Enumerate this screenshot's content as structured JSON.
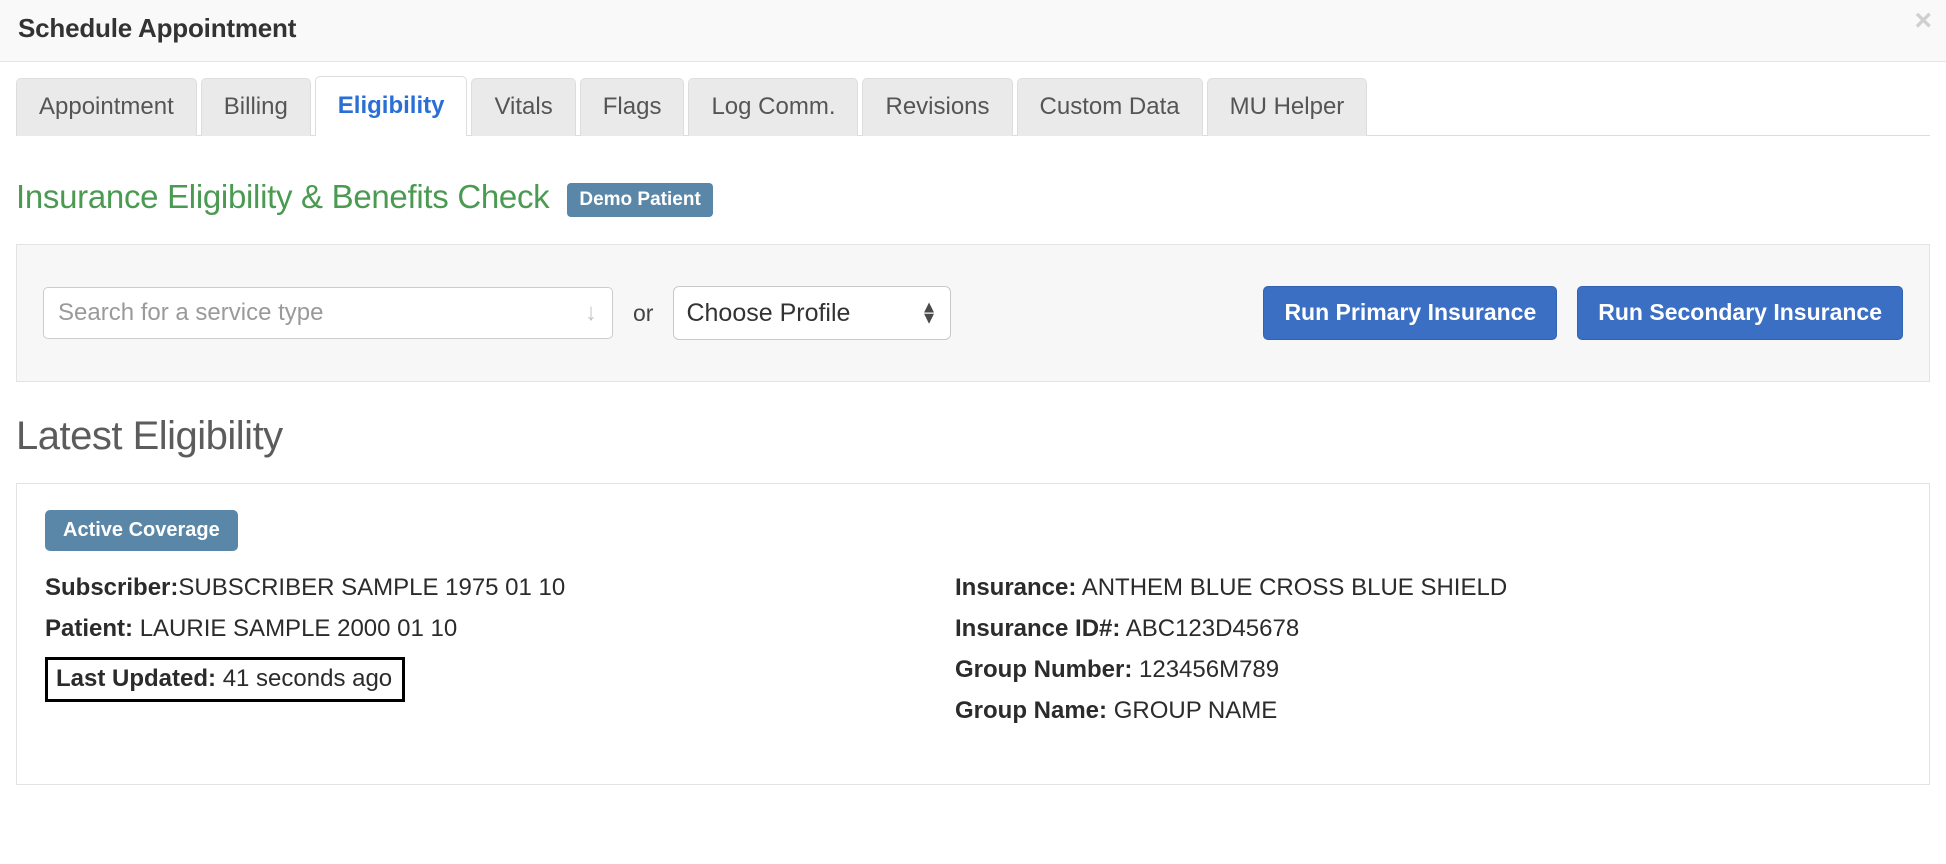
{
  "modal": {
    "title": "Schedule Appointment",
    "close_icon": "close-icon",
    "close_glyph": "×"
  },
  "tabs": [
    {
      "label": "Appointment",
      "active": false
    },
    {
      "label": "Billing",
      "active": false
    },
    {
      "label": "Eligibility",
      "active": true
    },
    {
      "label": "Vitals",
      "active": false
    },
    {
      "label": "Flags",
      "active": false
    },
    {
      "label": "Log Comm.",
      "active": false
    },
    {
      "label": "Revisions",
      "active": false
    },
    {
      "label": "Custom Data",
      "active": false
    },
    {
      "label": "MU Helper",
      "active": false
    }
  ],
  "section": {
    "title": "Insurance Eligibility & Benefits Check",
    "badge": "Demo Patient",
    "title_color": "#4a9a52",
    "badge_color": "#5a87a8"
  },
  "search_panel": {
    "service_search": {
      "value": "",
      "placeholder": "Search for a service type",
      "arrow_icon": "chevron-down-icon",
      "arrow_glyph": "↓"
    },
    "or_label": "or",
    "profile_select": {
      "selected": "Choose Profile",
      "options": [
        "Choose Profile"
      ],
      "stepper_up": "▲",
      "stepper_down": "▼"
    },
    "run_primary_label": "Run Primary Insurance",
    "run_secondary_label": "Run Secondary Insurance",
    "button_color": "#3a6fc4"
  },
  "latest_eligibility": {
    "heading": "Latest Eligibility",
    "status_badge": "Active Coverage",
    "left_column": [
      {
        "label": "Subscriber:",
        "value": "SUBSCRIBER SAMPLE 1975 01 10",
        "separator": "",
        "highlighted": false
      },
      {
        "label": "Patient:",
        "value": "LAURIE SAMPLE 2000 01 10",
        "separator": " ",
        "highlighted": false
      },
      {
        "label": "Last Updated:",
        "value": "41 seconds ago",
        "separator": " ",
        "highlighted": true
      }
    ],
    "right_column": [
      {
        "label": "Insurance:",
        "value": "ANTHEM BLUE CROSS BLUE SHIELD"
      },
      {
        "label": "Insurance ID#:",
        "value": "ABC123D45678"
      },
      {
        "label": "Group Number:",
        "value": "123456M789"
      },
      {
        "label": "Group Name:",
        "value": "GROUP NAME"
      }
    ]
  }
}
